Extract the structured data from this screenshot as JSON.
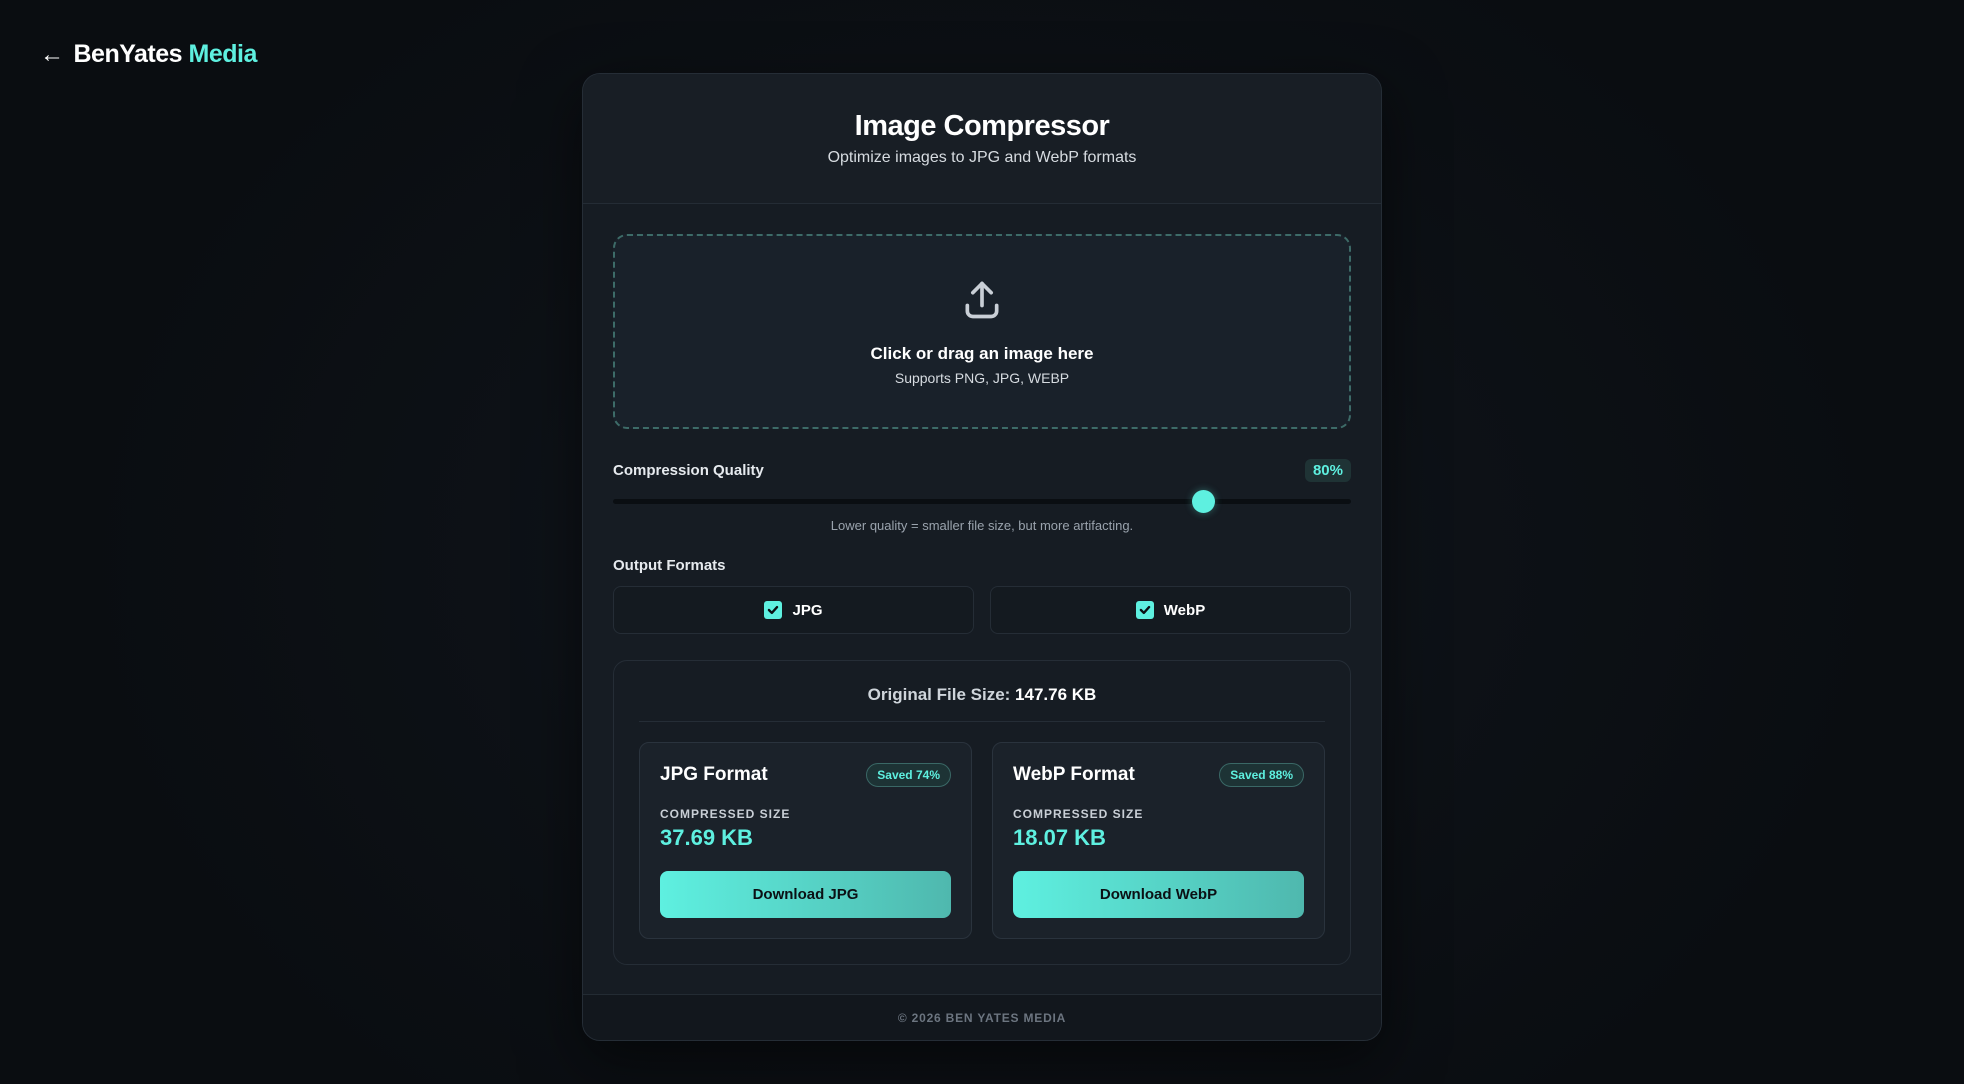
{
  "brand": {
    "back_arrow": "←",
    "name_part1": "BenYates",
    "name_part2": "Media"
  },
  "header": {
    "title": "Image Compressor",
    "subtitle": "Optimize images to JPG and WebP formats"
  },
  "dropzone": {
    "icon": "upload-icon",
    "title": "Click or drag an image here",
    "subtitle": "Supports PNG, JPG, WEBP"
  },
  "quality": {
    "label": "Compression Quality",
    "value_label": "80%",
    "value": 80,
    "hint": "Lower quality = smaller file size, but more artifacting."
  },
  "formats": {
    "label": "Output Formats",
    "options": [
      {
        "label": "JPG",
        "checked": true
      },
      {
        "label": "WebP",
        "checked": true
      }
    ]
  },
  "results": {
    "original_label": "Original File Size:",
    "original_value": "147.76 KB",
    "cards": [
      {
        "title": "JPG Format",
        "saved": "Saved 74%",
        "size_label": "COMPRESSED SIZE",
        "size_value": "37.69 KB",
        "button": "Download JPG"
      },
      {
        "title": "WebP Format",
        "saved": "Saved 88%",
        "size_label": "COMPRESSED SIZE",
        "size_value": "18.07 KB",
        "button": "Download WebP"
      }
    ]
  },
  "footer": {
    "text": "© 2026 BEN YATES MEDIA"
  },
  "colors": {
    "accent": "#5ef0e0",
    "background": "#0b0e12",
    "card": "#161c23"
  }
}
